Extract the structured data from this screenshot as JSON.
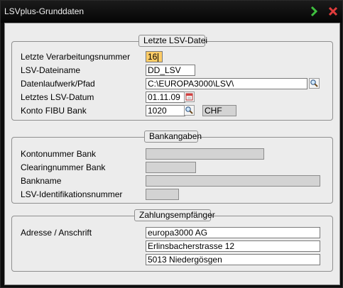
{
  "window": {
    "title": "LSVplus-Grunddaten"
  },
  "groups": {
    "letzte": {
      "legend": "Letzte LSV-Datei",
      "labels": {
        "verarbeitungsnummer": "Letzte Verarbeitungsnummer",
        "dateiname": "LSV-Dateiname",
        "pfad": "Datenlaufwerk/Pfad",
        "datum": "Letztes LSV-Datum",
        "konto": "Konto FIBU Bank"
      },
      "values": {
        "verarbeitungsnummer": "16",
        "dateiname": "DD_LSV",
        "pfad": "C:\\EUROPA3000\\LSV\\",
        "datum": "01.11.09",
        "konto": "1020",
        "waehrung": "CHF"
      }
    },
    "bank": {
      "legend": "Bankangaben",
      "labels": {
        "kontonummer": "Kontonummer Bank",
        "clearing": "Clearingnummer Bank",
        "bankname": "Bankname",
        "lsv_id": "LSV-Identifikationsnummer"
      },
      "values": {
        "kontonummer": "",
        "clearing": "",
        "bankname": "",
        "lsv_id": ""
      }
    },
    "empfaenger": {
      "legend": "Zahlungsempfänger",
      "labels": {
        "adresse": "Adresse / Anschrift"
      },
      "values": {
        "zeile1": "europa3000 AG",
        "zeile2": "Erlinsbacherstrasse 12",
        "zeile3": "5013 Niedergösgen"
      }
    }
  },
  "icons": {
    "next": "chevron-right-icon",
    "close": "close-icon",
    "browse": "magnifier-icon",
    "calendar": "calendar-icon"
  },
  "colors": {
    "focus": "#ffcc66",
    "next_icon": "#3fbf3f",
    "close_icon": "#e03c3c"
  }
}
